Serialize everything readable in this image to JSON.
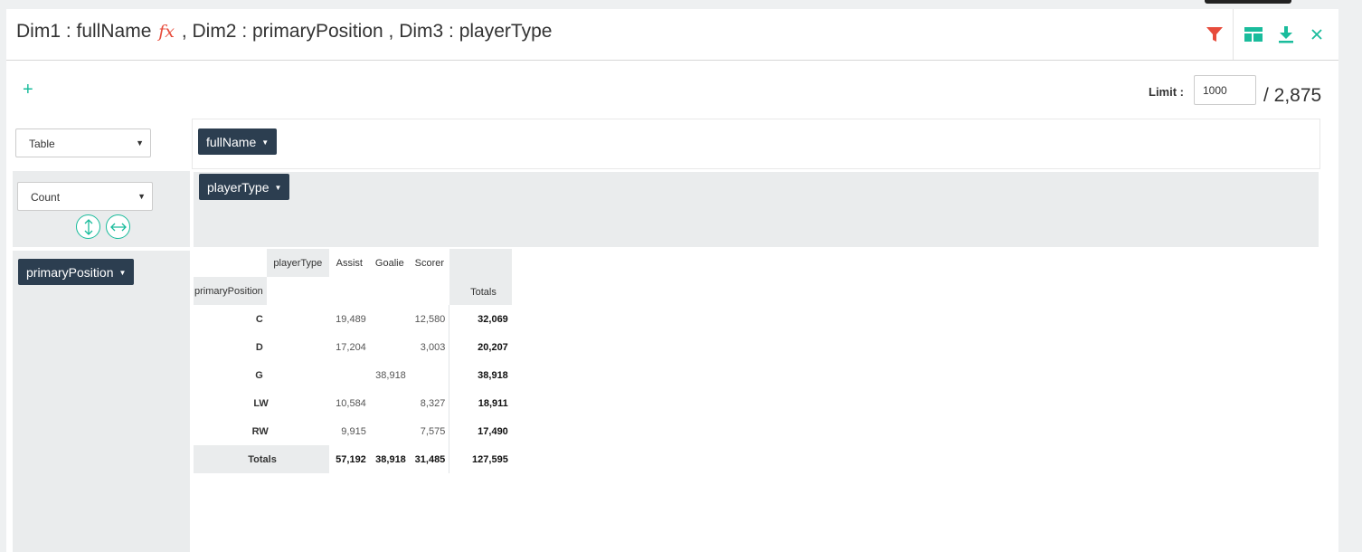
{
  "header": {
    "title_part1": "Dim1 : fullName",
    "title_fx": "fx",
    "title_part2": ", Dim2 : primaryPosition , Dim3 : playerType",
    "icons": {
      "filter": "filter-icon",
      "layout": "table-layout-icon",
      "download": "download-icon",
      "close": "close-icon"
    }
  },
  "colors": {
    "accent": "#1abc9c",
    "filter": "#e74c3c",
    "pill": "#2c3e50"
  },
  "add_label": "+",
  "limit": {
    "label": "Limit :",
    "value": "1000",
    "total": "/ 2,875"
  },
  "renderer": {
    "selected": "Table"
  },
  "aggregator": {
    "selected": "Count"
  },
  "pills": {
    "cols_pool": "fullName",
    "col_dim": "playerType",
    "row_dim": "primaryPosition"
  },
  "pivot": {
    "col_attr": "playerType",
    "row_attr": "primaryPosition",
    "columns": [
      "Assist",
      "Goalie",
      "Scorer"
    ],
    "totals_label": "Totals",
    "rows": [
      {
        "label": "C",
        "values": [
          "19,489",
          "",
          "12,580"
        ],
        "total": "32,069"
      },
      {
        "label": "D",
        "values": [
          "17,204",
          "",
          "3,003"
        ],
        "total": "20,207"
      },
      {
        "label": "G",
        "values": [
          "",
          "38,918",
          ""
        ],
        "total": "38,918"
      },
      {
        "label": "LW",
        "values": [
          "10,584",
          "",
          "8,327"
        ],
        "total": "18,911"
      },
      {
        "label": "RW",
        "values": [
          "9,915",
          "",
          "7,575"
        ],
        "total": "17,490"
      }
    ],
    "col_totals": [
      "57,192",
      "38,918",
      "31,485"
    ],
    "grand_total": "127,595"
  }
}
